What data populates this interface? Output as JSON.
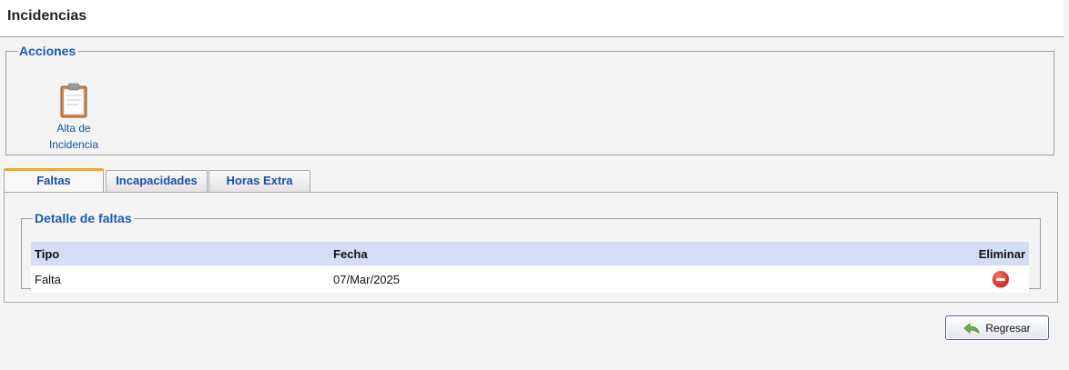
{
  "page": {
    "title": "Incidencias"
  },
  "acciones": {
    "legend": "Acciones",
    "items": [
      {
        "label_line1": "Alta de",
        "label_line2": "Incidencia",
        "icon": "clipboard-icon"
      }
    ]
  },
  "tabs": [
    {
      "label": "Faltas",
      "active": true
    },
    {
      "label": "Incapacidades",
      "active": false
    },
    {
      "label": "Horas Extra",
      "active": false
    }
  ],
  "detalle": {
    "legend": "Detalle de faltas",
    "columns": {
      "tipo": "Tipo",
      "fecha": "Fecha",
      "eliminar": "Eliminar"
    },
    "rows": [
      {
        "tipo": "Falta",
        "fecha": "07/Mar/2025",
        "eliminar_icon": "delete-icon"
      }
    ]
  },
  "buttons": {
    "regresar": "Regresar",
    "regresar_icon": "back-arrow-icon"
  },
  "colors": {
    "accent": "#1a5bb5",
    "active_tab_border": "#f5a623",
    "table_header_bg": "#d5dcf6",
    "delete": "#d02a1a"
  }
}
